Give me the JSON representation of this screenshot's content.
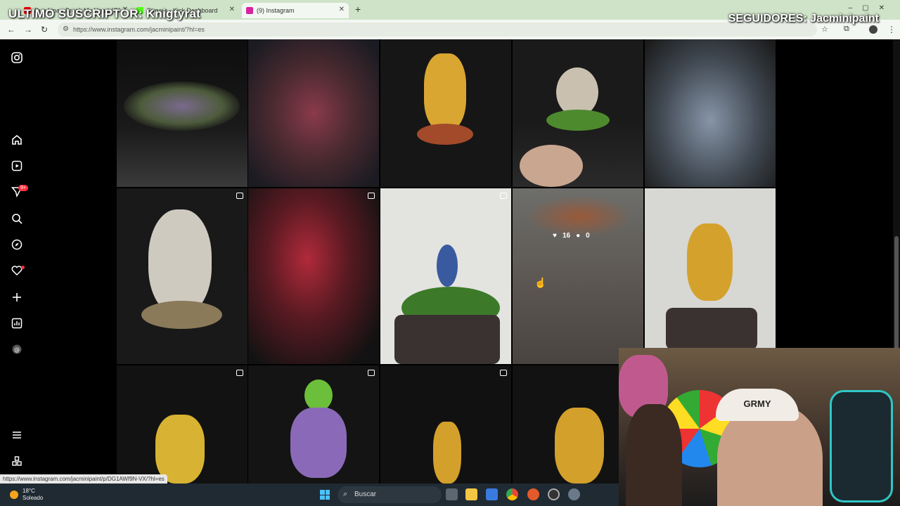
{
  "browser": {
    "tabs": [
      {
        "title": "Dua Lipa - Break My Heart (Of",
        "favicon": "youtube-icon",
        "color": "#ff0000"
      },
      {
        "title": "Stream - Kick Dashboard",
        "favicon": "kick-icon",
        "color": "#53fc18"
      },
      {
        "title": "(9) Instagram",
        "favicon": "instagram-icon",
        "color": "#d6249f"
      }
    ],
    "url": "https://www.instagram.com/jacminipaint/?hl=es",
    "new_tab": "+"
  },
  "overlay": {
    "last_subscriber": "ULTIMO SUSCRIPTOR: Knigtyrat",
    "followers": "SEGUIDORES: Jacminipaint"
  },
  "sidebar": {
    "items": [
      {
        "name": "instagram-logo-icon"
      },
      {
        "name": "home-icon"
      },
      {
        "name": "reels-icon"
      },
      {
        "name": "messages-icon",
        "badge": "9+"
      },
      {
        "name": "search-icon"
      },
      {
        "name": "explore-icon"
      },
      {
        "name": "notifications-icon"
      },
      {
        "name": "create-icon"
      },
      {
        "name": "dashboard-icon"
      },
      {
        "name": "threads-icon"
      },
      {
        "name": "menu-icon"
      },
      {
        "name": "also-from-meta-icon"
      }
    ]
  },
  "grid": {
    "hover_likes": "16",
    "hover_comments": "0"
  },
  "statusbar": {
    "link": "https://www.instagram.com/jacminipaint/p/DG1AWf9N-VX/?hl=es"
  },
  "taskbar": {
    "temperature": "18°C",
    "weather": "Soleado",
    "search_placeholder": "Buscar"
  },
  "webcam": {
    "cap_text": "GRMY"
  }
}
